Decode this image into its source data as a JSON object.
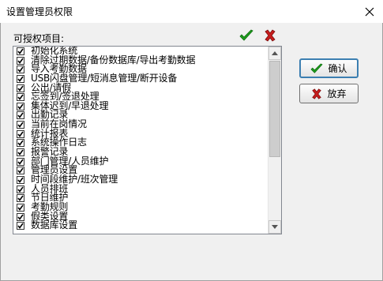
{
  "window": {
    "title": "设置管理员权限"
  },
  "list_label": "可授权项目:",
  "permissions": [
    {
      "label": "初始化系统",
      "checked": true
    },
    {
      "label": "清除过期数据/备份数据库/导出考勤数据",
      "checked": true
    },
    {
      "label": "导入考勤数据",
      "checked": true
    },
    {
      "label": "USB闪盘管理/短消息管理/断开设备",
      "checked": true
    },
    {
      "label": "公出/请假",
      "checked": true
    },
    {
      "label": "忘签到/签退处理",
      "checked": true
    },
    {
      "label": "集体迟到/早退处理",
      "checked": true
    },
    {
      "label": "出勤记录",
      "checked": true
    },
    {
      "label": "当前在岗情况",
      "checked": true
    },
    {
      "label": "统计报表",
      "checked": true
    },
    {
      "label": "系统操作日志",
      "checked": true
    },
    {
      "label": "报警记录",
      "checked": true
    },
    {
      "label": "部门管理/人员维护",
      "checked": true
    },
    {
      "label": "管理员设置",
      "checked": true
    },
    {
      "label": "时间段维护/班次管理",
      "checked": true
    },
    {
      "label": "人员排班",
      "checked": true
    },
    {
      "label": "节日维护",
      "checked": true
    },
    {
      "label": "考勤规则",
      "checked": true
    },
    {
      "label": "假类设置",
      "checked": true
    },
    {
      "label": "数据库设置",
      "checked": true
    }
  ],
  "buttons": {
    "ok_label": "确认",
    "cancel_label": "放弃"
  },
  "colors": {
    "check_green": "#1e9e1e",
    "cross_red": "#c81e1e",
    "accent_blue": "#3c7fb1"
  },
  "icons": {
    "select_all": "green-check-icon",
    "clear_all": "red-cross-icon"
  }
}
